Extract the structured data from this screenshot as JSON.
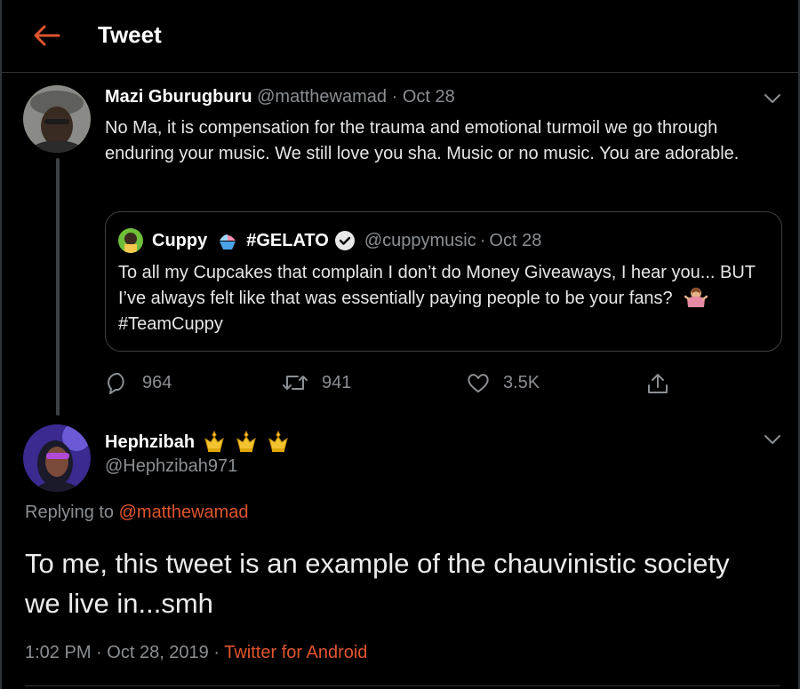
{
  "header": {
    "title": "Tweet",
    "back_icon": "arrow-left-icon",
    "accent": "#e0552e"
  },
  "tweet1": {
    "display_name": "Mazi Gburugburu",
    "handle": "@matthewamad",
    "separator": "·",
    "date": "Oct 28",
    "text": "No Ma, it is compensation for the trauma and emotional turmoil we go through enduring your music. We still love you sha. Music or no music. You are adorable.",
    "quoted": {
      "display_name": "Cuppy",
      "tag": "#GELATO",
      "handle": "@cuppymusic",
      "separator": "·",
      "date": "Oct 28",
      "verified_icon": "verified-badge-icon",
      "shaved_ice_icon": "shaved-ice-emoji",
      "text_before": "To all my Cupcakes that complain I don’t do Money Giveaways, I hear you... BUT I’ve always felt like that was essentially paying people to be your fans?",
      "shrug_icon": "person-shrugging-emoji",
      "hashtag": "#TeamCuppy"
    },
    "stats": {
      "replies": "964",
      "retweets": "941",
      "likes": "3.5K"
    }
  },
  "tweet2": {
    "display_name": "Hephzibah",
    "crown_icon": "crown-emoji",
    "handle": "@Hephzibah971",
    "replying_prefix": "Replying to",
    "replying_to": "@matthewamad",
    "text": "To me, this tweet is an example of the chauvinistic society we live in...smh",
    "time": "1:02 PM",
    "separator": "·",
    "date": "Oct 28, 2019",
    "separator2": "·",
    "source": "Twitter for Android"
  },
  "colors": {
    "background": "#000000",
    "border": "#2f3336",
    "muted": "#8b8f93",
    "text": "#e6e6e6"
  }
}
